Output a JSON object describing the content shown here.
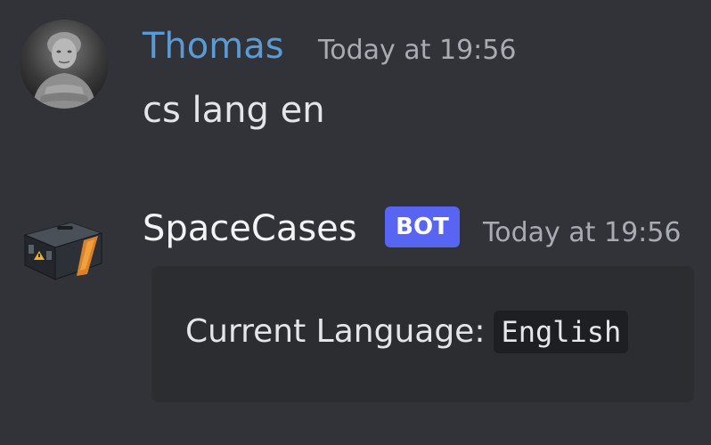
{
  "messages": [
    {
      "author": "Thomas",
      "timestamp": "Today at 19:56",
      "content": "cs lang en",
      "avatar": "user-portrait-avatar"
    },
    {
      "author": "SpaceCases",
      "badge": "BOT",
      "timestamp": "Today at 19:56",
      "embed": {
        "label": "Current Language:",
        "value": "English"
      },
      "avatar": "case-box-avatar"
    }
  ],
  "colors": {
    "background": "#313338",
    "embed_background": "#2b2d31",
    "username_thomas": "#5b9bd5",
    "bot_badge": "#5865f2",
    "timestamp": "#a9abb3"
  }
}
